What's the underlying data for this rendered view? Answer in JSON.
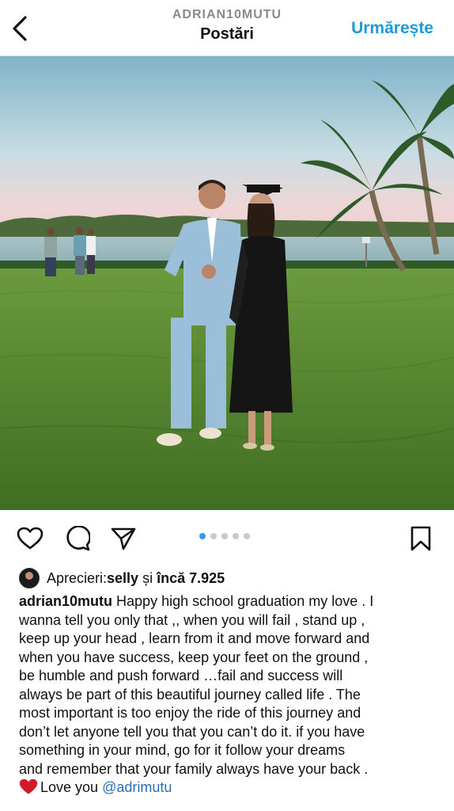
{
  "header": {
    "username": "ADRIAN10MUTU",
    "title": "Postări",
    "follow_label": "Urmărește"
  },
  "actions": {
    "carousel_count": 5,
    "carousel_active": 1
  },
  "likes": {
    "prefix": "Aprecieri: ",
    "liker": "selly",
    "connector": " și ",
    "more": "încă 7.925"
  },
  "caption": {
    "username": "adrian10mutu",
    "lines": [
      " Happy high school graduation my love . I",
      "wanna tell you only that ,, when you will fail , stand up ,",
      "keep up your head , learn from it and move forward and",
      "when you have success, keep your feet on the ground ,",
      "be humble and push forward …fail and success will",
      "always be part of this beautiful journey called life . The",
      "most important is too enjoy the ride of this journey and",
      "don’t let anyone tell you that you can’t do it. if you have",
      "something in your mind, go for it follow your dreams",
      "and remember that your family always have your back ."
    ],
    "love_text": "Love you ",
    "mention": "@adrimutu"
  },
  "colors": {
    "accent": "#1e9bd8",
    "mention": "#2a6fb6",
    "heart": "#d11a2a"
  },
  "icons": [
    "back-chevron-icon",
    "heart-icon",
    "comment-icon",
    "share-icon",
    "bookmark-icon",
    "red-heart-emoji-icon"
  ]
}
